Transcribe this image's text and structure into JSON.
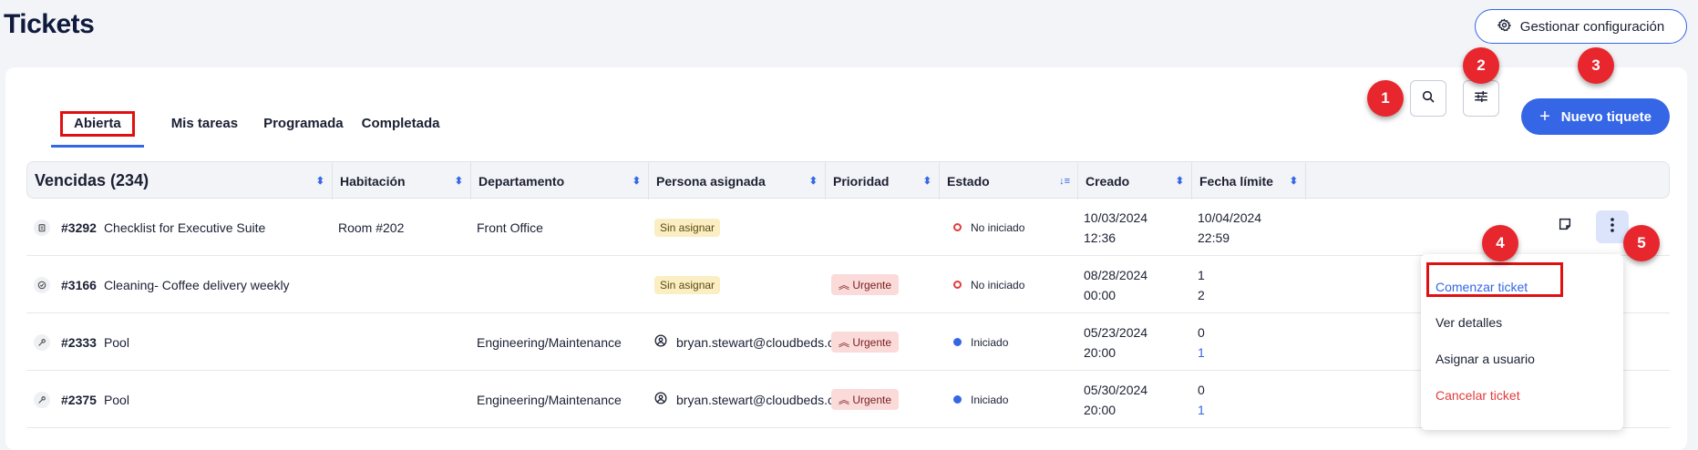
{
  "page": {
    "title": "Tickets"
  },
  "header": {
    "config_button": "Gestionar configuración"
  },
  "tabs": [
    {
      "label": "Abierta"
    },
    {
      "label": "Mis tareas"
    },
    {
      "label": "Programada"
    },
    {
      "label": "Completada"
    }
  ],
  "toolbar": {
    "new_button": "Nuevo tiquete"
  },
  "badges": [
    "1",
    "2",
    "3",
    "4",
    "5"
  ],
  "table": {
    "columns": [
      {
        "label": "Vencidas (234)"
      },
      {
        "label": "Habitación"
      },
      {
        "label": "Departamento"
      },
      {
        "label": "Persona asignada"
      },
      {
        "label": "Prioridad"
      },
      {
        "label": "Estado"
      },
      {
        "label": "Creado"
      },
      {
        "label": "Fecha límite"
      }
    ],
    "rows": [
      {
        "id": "#3292",
        "title": "Checklist for Executive Suite",
        "room": "Room #202",
        "department": "Front Office",
        "assignee": "Sin asignar",
        "priority": "",
        "status": "No iniciado",
        "created_date": "10/03/2024",
        "created_time": "12:36",
        "due_date": "10/04/2024",
        "due_time": "22:59"
      },
      {
        "id": "#3166",
        "title": "Cleaning- Coffee delivery weekly",
        "room": "",
        "department": "",
        "assignee": "Sin asignar",
        "priority": "Urgente",
        "status": "No iniciado",
        "created_date": "08/28/2024",
        "created_time": "00:00",
        "due_date": "1",
        "due_time": "2"
      },
      {
        "id": "#2333",
        "title": "Pool",
        "room": "",
        "department": "Engineering/Maintenance",
        "assignee": "bryan.stewart@cloudbeds.c...",
        "priority": "Urgente",
        "status": "Iniciado",
        "created_date": "05/23/2024",
        "created_time": "20:00",
        "due_date": "0",
        "due_time": "1"
      },
      {
        "id": "#2375",
        "title": "Pool",
        "room": "",
        "department": "Engineering/Maintenance",
        "assignee": "bryan.stewart@cloudbeds.c...",
        "priority": "Urgente",
        "status": "Iniciado",
        "created_date": "05/30/2024",
        "created_time": "20:00",
        "due_date": "0",
        "due_time": "1"
      }
    ]
  },
  "context_menu": {
    "items": [
      {
        "label": "Comenzar ticket"
      },
      {
        "label": "Ver detalles"
      },
      {
        "label": "Asignar a usuario"
      },
      {
        "label": "Cancelar ticket"
      }
    ]
  },
  "colors": {
    "accent": "#3466e6",
    "badge": "#e8262d",
    "urgent_bg": "#fbdada",
    "unassigned_bg": "#fbeec2",
    "danger": "#e23b3b"
  }
}
